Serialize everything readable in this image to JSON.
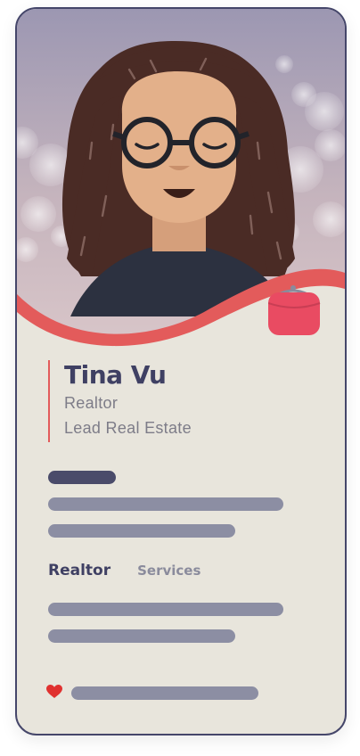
{
  "profile": {
    "name": "Tina Vu",
    "role": "Realtor",
    "company": "Lead Real Estate"
  },
  "tabs": [
    {
      "label": "Realtor",
      "active": true
    },
    {
      "label": "Services",
      "active": false
    }
  ],
  "icons": {
    "purse": "purse-icon",
    "heart": "heart-icon"
  },
  "colors": {
    "accent": "#e35b5b",
    "card_background": "#e8e5dc",
    "primary_text": "#3f4063",
    "secondary_text": "#7d7c88",
    "placeholder_bar": "#8c8ea3",
    "placeholder_bar_dark": "#4a4b6a"
  }
}
